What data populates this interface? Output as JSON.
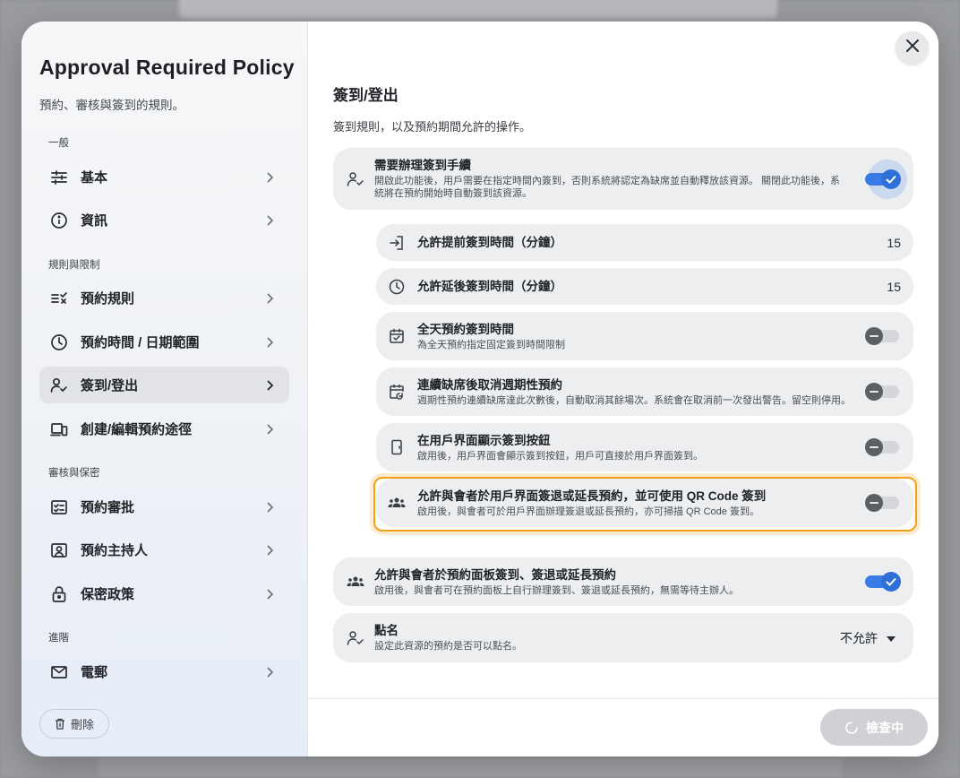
{
  "sidebar": {
    "title": "Approval Required Policy",
    "subtitle": "預約、審核與簽到的規則。",
    "groups": [
      {
        "label": "一般"
      },
      {
        "label": "規則與限制"
      },
      {
        "label": "審核與保密"
      },
      {
        "label": "進階"
      }
    ],
    "items": [
      {
        "label": "基本",
        "icon": "sliders-icon"
      },
      {
        "label": "資訊",
        "icon": "info-icon"
      },
      {
        "label": "預約規則",
        "icon": "rules-icon"
      },
      {
        "label": "預約時間 / 日期範圍",
        "icon": "clock-icon"
      },
      {
        "label": "簽到/登出",
        "icon": "person-check-icon",
        "active": true
      },
      {
        "label": "創建/編輯預約途徑",
        "icon": "devices-icon"
      },
      {
        "label": "預約審批",
        "icon": "approval-icon"
      },
      {
        "label": "預約主持人",
        "icon": "host-icon"
      },
      {
        "label": "保密政策",
        "icon": "lock-icon"
      },
      {
        "label": "電郵",
        "icon": "mail-icon"
      }
    ],
    "delete_label": "刪除"
  },
  "main": {
    "title": "簽到/登出",
    "description": "簽到規則，以及預約期間允許的操作。",
    "rows": [
      {
        "title": "需要辦理簽到手續",
        "desc": "開啟此功能後，用戶需要在指定時間內簽到，否則系統將認定為缺席並自動釋放該資源。 關閉此功能後，系統將在預約開始時自動簽到該資源。",
        "toggle": "on"
      },
      {
        "title": "允許提前簽到時間（分鐘）",
        "value": "15"
      },
      {
        "title": "允許延後簽到時間（分鐘）",
        "value": "15"
      },
      {
        "title": "全天預約簽到時間",
        "desc": "為全天預約指定固定簽到時間限制",
        "toggle": "off"
      },
      {
        "title": "連續缺席後取消週期性預約",
        "desc": "週期性預約連續缺席達此次數後，自動取消其餘場次。系統會在取消前一次發出警告。留空則停用。",
        "toggle": "off"
      },
      {
        "title": "在用戶界面顯示簽到按鈕",
        "desc": "啟用後，用戶界面會顯示簽到按鈕，用戶可直接於用戶界面簽到。",
        "toggle": "off"
      },
      {
        "title": "允許與會者於用戶界面簽退或延長預約，並可使用 QR Code 簽到",
        "desc": "啟用後，與會者可於用戶界面辦理簽退或延長預約，亦可掃描 QR Code 簽到。",
        "toggle": "off",
        "highlighted": true
      },
      {
        "title": "允許與會者於預約面板簽到、簽退或延長預約",
        "desc": "啟用後，與會者可在預約面板上自行辦理簽到、簽退或延長預約，無需等待主辦人。",
        "toggle": "on"
      },
      {
        "title": "點名",
        "desc": "設定此資源的預約是否可以點名。",
        "select_value": "不允許"
      }
    ],
    "check_label": "檢查中"
  },
  "colors": {
    "accent": "#3a7be8",
    "highlight": "#f0a116"
  }
}
